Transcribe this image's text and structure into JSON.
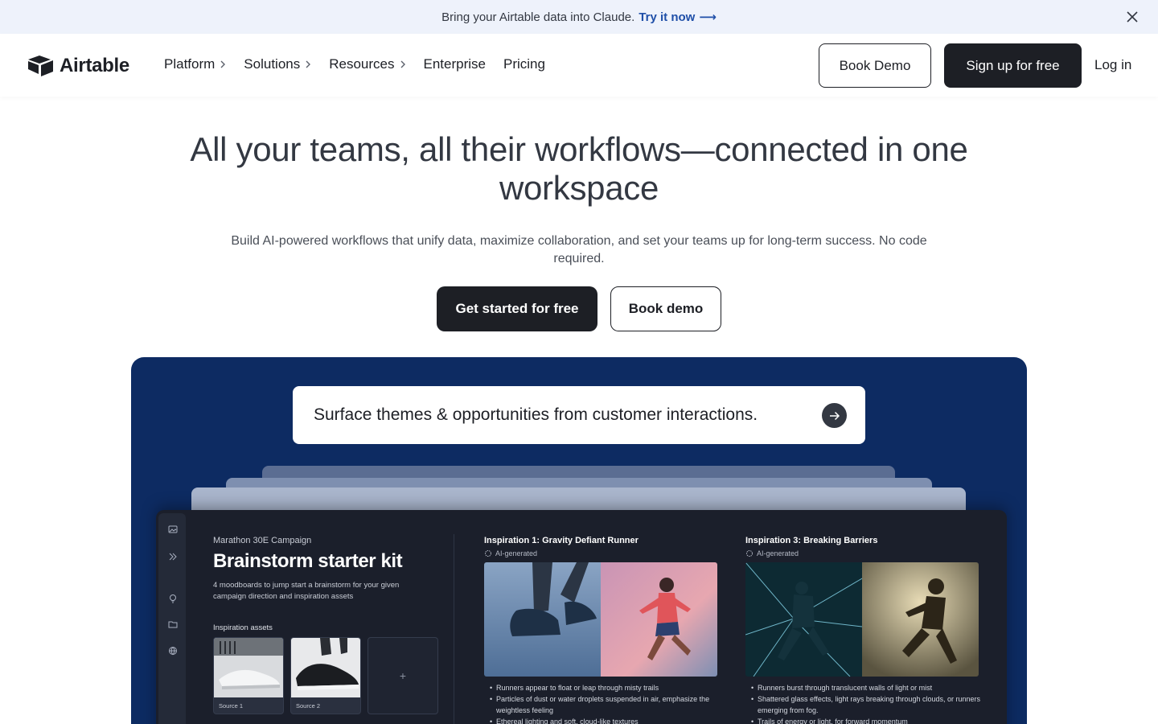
{
  "announcement": {
    "text": "Bring your Airtable data into Claude.",
    "link": "Try it now",
    "arrow": "⟶"
  },
  "nav": {
    "brand": "Airtable",
    "items": [
      {
        "label": "Platform",
        "has_chevron": true
      },
      {
        "label": "Solutions",
        "has_chevron": true
      },
      {
        "label": "Resources",
        "has_chevron": true
      },
      {
        "label": "Enterprise",
        "has_chevron": false
      },
      {
        "label": "Pricing",
        "has_chevron": false
      }
    ],
    "book_demo": "Book Demo",
    "sign_up": "Sign up for free",
    "login": "Log in"
  },
  "hero": {
    "title": "All your teams, all their workflows—connected in one workspace",
    "subtitle": "Build AI-powered workflows that unify data, maximize collaboration, and set your teams up for long-term success. No code required.",
    "cta_primary": "Get started for free",
    "cta_secondary": "Book demo"
  },
  "showcase": {
    "prompt": "Surface themes & opportunities from customer interactions.",
    "app": {
      "campaign": "Marathon 30E Campaign",
      "title": "Brainstorm starter kit",
      "description": "4 moodboards to jump start a brainstorm for your given campaign direction and inspiration assets",
      "assets_label": "Inspiration assets",
      "sources": [
        "Source 1",
        "Source 2"
      ],
      "add_symbol": "+",
      "inspirations": [
        {
          "title": "Inspiration 1: Gravity Defiant Runner",
          "tag": "AI-generated",
          "bullets": [
            "Runners appear to float or leap through misty trails",
            "Particles of dust or water droplets suspended in air, emphasize the weightless feeling",
            "Ethereal lighting and soft, cloud-like textures"
          ]
        },
        {
          "title": "Inspiration 3: Breaking Barriers",
          "tag": "AI-generated",
          "bullets": [
            "Runners burst through translucent walls of light or mist",
            "Shattered glass effects, light rays breaking through clouds, or runners emerging from fog.",
            "Trails of energy or light, for forward momentum"
          ]
        }
      ]
    }
  },
  "colors": {
    "announce_bg": "#eef2fb",
    "link": "#1f4fa8",
    "dark": "#1d1f25",
    "showcase_bg": "#0d2b62"
  }
}
